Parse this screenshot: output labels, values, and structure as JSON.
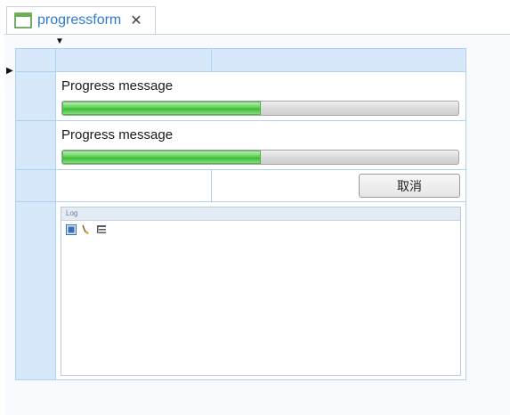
{
  "tab": {
    "title": "progressform",
    "close_glyph": "✕",
    "icon": "form-window-icon"
  },
  "designer": {
    "column_marker": "▼",
    "row_marker": "▶"
  },
  "form": {
    "progress_rows": [
      {
        "label": "Progress message",
        "percent": 50
      },
      {
        "label": "Progress message",
        "percent": 50
      }
    ],
    "cancel_label": "取消",
    "log": {
      "title": "Log",
      "tools": [
        "log-save-icon",
        "log-clear-icon",
        "log-format-icon"
      ]
    }
  },
  "colors": {
    "accent": "#2b7bd4",
    "grid_header": "#d6e8fa",
    "grid_line": "#aed1f3",
    "progress_green": "#3dbb35"
  }
}
